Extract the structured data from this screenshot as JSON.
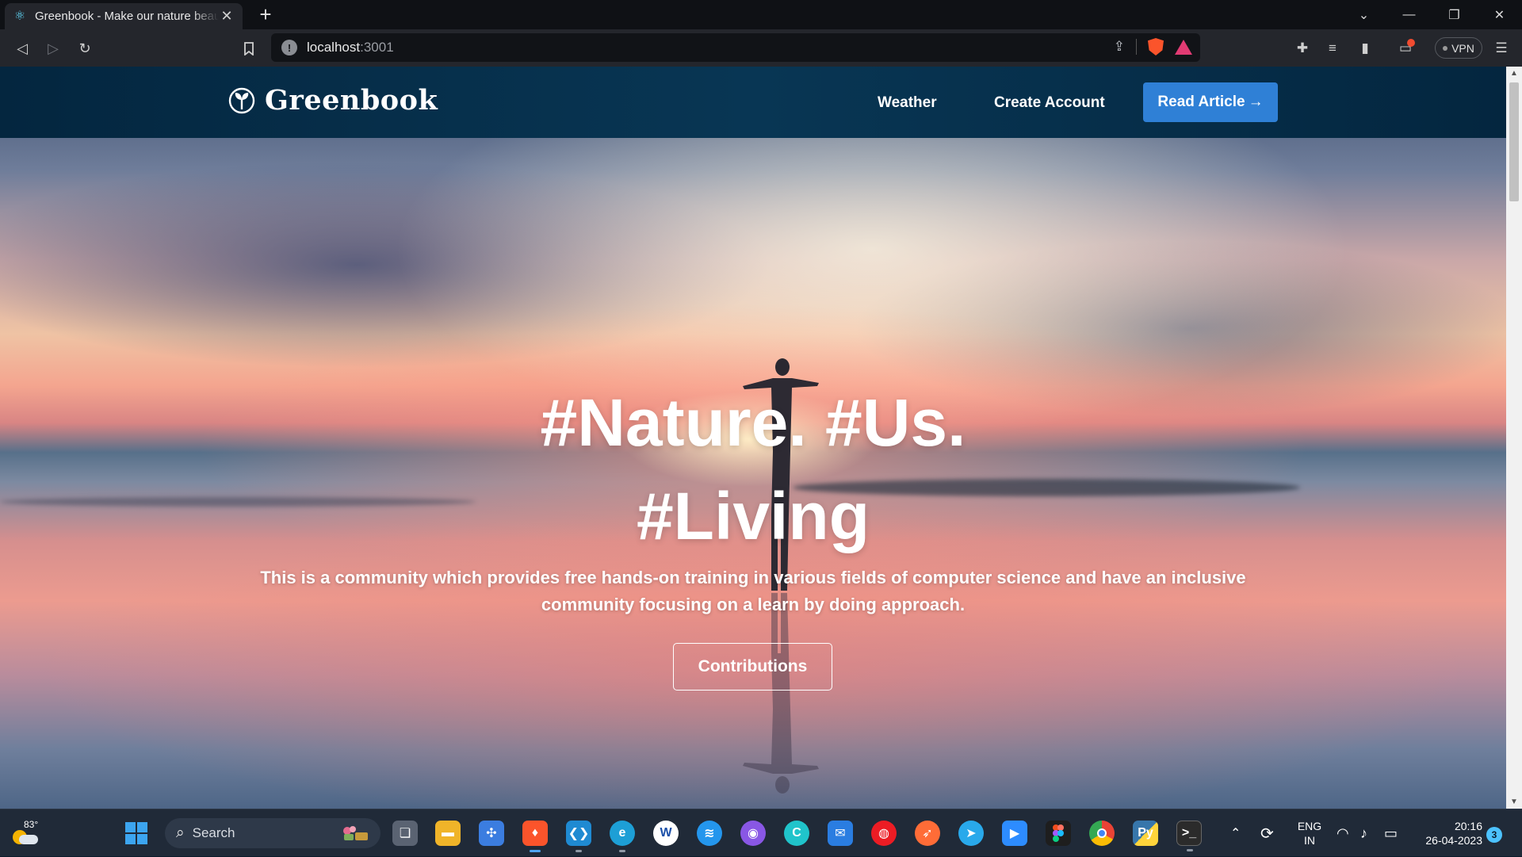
{
  "browser": {
    "tab_title": "Greenbook - Make our nature beautiful",
    "new_tab_symbol": "+",
    "tab_close_symbol": "✕",
    "url_host": "localhost",
    "url_port": ":3001",
    "vpn_label": "VPN",
    "accent_color": "#fb542b"
  },
  "site": {
    "brand_name": "Greenbook",
    "nav": {
      "weather": "Weather",
      "create_account": "Create Account",
      "read_article": "Read Article",
      "read_article_arrow": "→"
    },
    "hero": {
      "title_line1": "#Nature. #Us.",
      "title_line2": "#Living",
      "subtitle": "This is a community which provides free hands-on training in various fields of computer science and have an inclusive community focusing on a learn by doing approach.",
      "cta": "Contributions"
    },
    "colors": {
      "nav_bg": "#04263f",
      "primary_button": "#2f80d6"
    }
  },
  "taskbar": {
    "weather_temp": "83°",
    "search_placeholder": "Search",
    "apps": [
      "task-view",
      "file-explorer",
      "copilot",
      "brave",
      "vscode",
      "edge",
      "app-w",
      "docker",
      "github-desktop",
      "canva",
      "mail",
      "authy",
      "postman",
      "telegram",
      "zoom",
      "figma",
      "chrome",
      "python",
      "terminal"
    ],
    "language_line1": "ENG",
    "language_line2": "IN",
    "time": "20:16",
    "date": "26-04-2023",
    "notification_count": "3"
  }
}
